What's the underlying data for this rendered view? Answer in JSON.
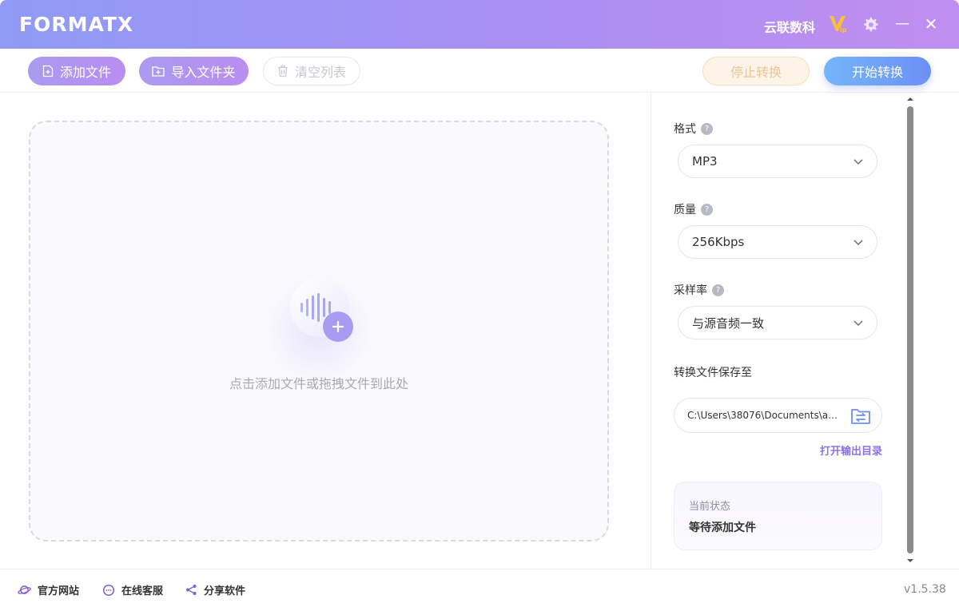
{
  "app": {
    "logo": "FORMATX",
    "brand": "云联数科"
  },
  "toolbar": {
    "add_file": "添加文件",
    "import_folder": "导入文件夹",
    "clear_list": "清空列表",
    "stop_convert": "停止转换",
    "start_convert": "开始转换"
  },
  "dropzone": {
    "hint": "点击添加文件或拖拽文件到此处"
  },
  "settings": {
    "format_label": "格式",
    "format_value": "MP3",
    "quality_label": "质量",
    "quality_value": "256Kbps",
    "samplerate_label": "采样率",
    "samplerate_value": "与源音频一致",
    "save_to_label": "转换文件保存至",
    "save_path": "C:\\Users\\38076\\Documents\\an...",
    "open_output": "打开输出目录"
  },
  "status": {
    "label": "当前状态",
    "value": "等待添加文件"
  },
  "footer": {
    "website": "官方网站",
    "support": "在线客服",
    "share": "分享软件",
    "version": "v1.5.38"
  },
  "icons": {
    "vip": "vip-icon",
    "settings": "gear-icon",
    "minimize": "minimize-icon",
    "close": "close-icon",
    "add_file": "file-plus-icon",
    "import_folder": "folder-plus-icon",
    "clear": "trash-icon",
    "audio": "audio-wave-icon",
    "folder_swap": "folder-swap-icon",
    "website": "planet-icon",
    "support": "chat-icon",
    "share": "share-icon"
  },
  "colors": {
    "header_start": "#8f9bf5",
    "header_end": "#c08ef0",
    "accent_purple": "#a99bf0",
    "accent_blue": "#6d8ff5",
    "link": "#8a72e8"
  }
}
